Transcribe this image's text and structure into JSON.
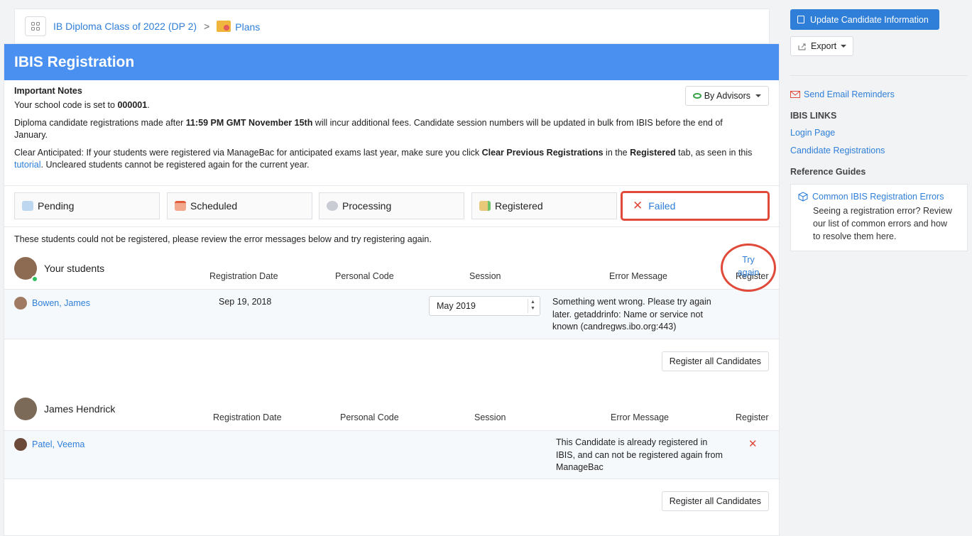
{
  "breadcrumb": {
    "class_name": "IB Diploma Class of 2022 (DP 2)",
    "separator": ">",
    "current": "Plans"
  },
  "header": {
    "title": "IBIS Registration"
  },
  "notes": {
    "heading": "Important Notes",
    "school_code_prefix": "Your school code is set to ",
    "school_code": "000001",
    "school_code_suffix": ".",
    "deadline_prefix": "Diploma candidate registrations made after ",
    "deadline": "11:59 PM GMT November 15th",
    "deadline_suffix": " will incur additional fees. Candidate session numbers will be updated in bulk from IBIS before the end of January.",
    "clear_prefix": "Clear Anticipated: If your students were registered via ManageBac for anticipated exams last year, make sure you click ",
    "clear_action": "Clear Previous Registrations",
    "clear_mid": " in the ",
    "clear_tab": "Registered",
    "clear_tab_suffix": " tab, as seen in this ",
    "tutorial_link": "tutorial",
    "clear_suffix": ". Uncleared students cannot be registered again for the current year."
  },
  "advisors_button": "By Advisors",
  "tabs": [
    "Pending",
    "Scheduled",
    "Processing",
    "Registered",
    "Failed"
  ],
  "intro": "These students could not be registered, please review the error messages below and try registering again.",
  "columns": {
    "registration_date": "Registration Date",
    "personal_code": "Personal Code",
    "session": "Session",
    "error_message": "Error Message",
    "register": "Register"
  },
  "groups": [
    {
      "advisor": "Your students",
      "students": [
        {
          "name": "Bowen, James",
          "registration_date": "Sep 19, 2018",
          "personal_code": "",
          "session": "May 2019",
          "error_lines": [
            "Something went wrong. Please try again",
            "later. getaddrinfo: Name or service not",
            "known (candregws.ibo.org:443)"
          ],
          "register_action": [
            "Try",
            "again"
          ]
        }
      ],
      "footer_button": "Register all Candidates"
    },
    {
      "advisor": "James Hendrick",
      "students": [
        {
          "name": "Patel, Veema",
          "registration_date": "",
          "personal_code": "",
          "session": "",
          "error_lines": [
            "This Candidate is already registered in",
            "IBIS, and can not be registered again from",
            "ManageBac"
          ],
          "register_action": "✕"
        }
      ],
      "footer_button": "Register all Candidates"
    }
  ],
  "sidebar": {
    "update_button": "Update Candidate Information",
    "export_button": "Export",
    "send_reminders": "Send Email Reminders",
    "ibis_links_heading": "IBIS LINKS",
    "login_page": "Login Page",
    "candidate_registrations": "Candidate Registrations",
    "reference_heading": "Reference Guides",
    "guide_title": "Common IBIS Registration Errors",
    "guide_lines": [
      "Seeing a registration error? Review",
      "our list of common errors and how",
      "to resolve them here."
    ]
  },
  "colors": {
    "accent": "#2f7fd9",
    "header": "#4a90f0",
    "highlight": "#e04a3a",
    "online": "#2ec05b"
  }
}
